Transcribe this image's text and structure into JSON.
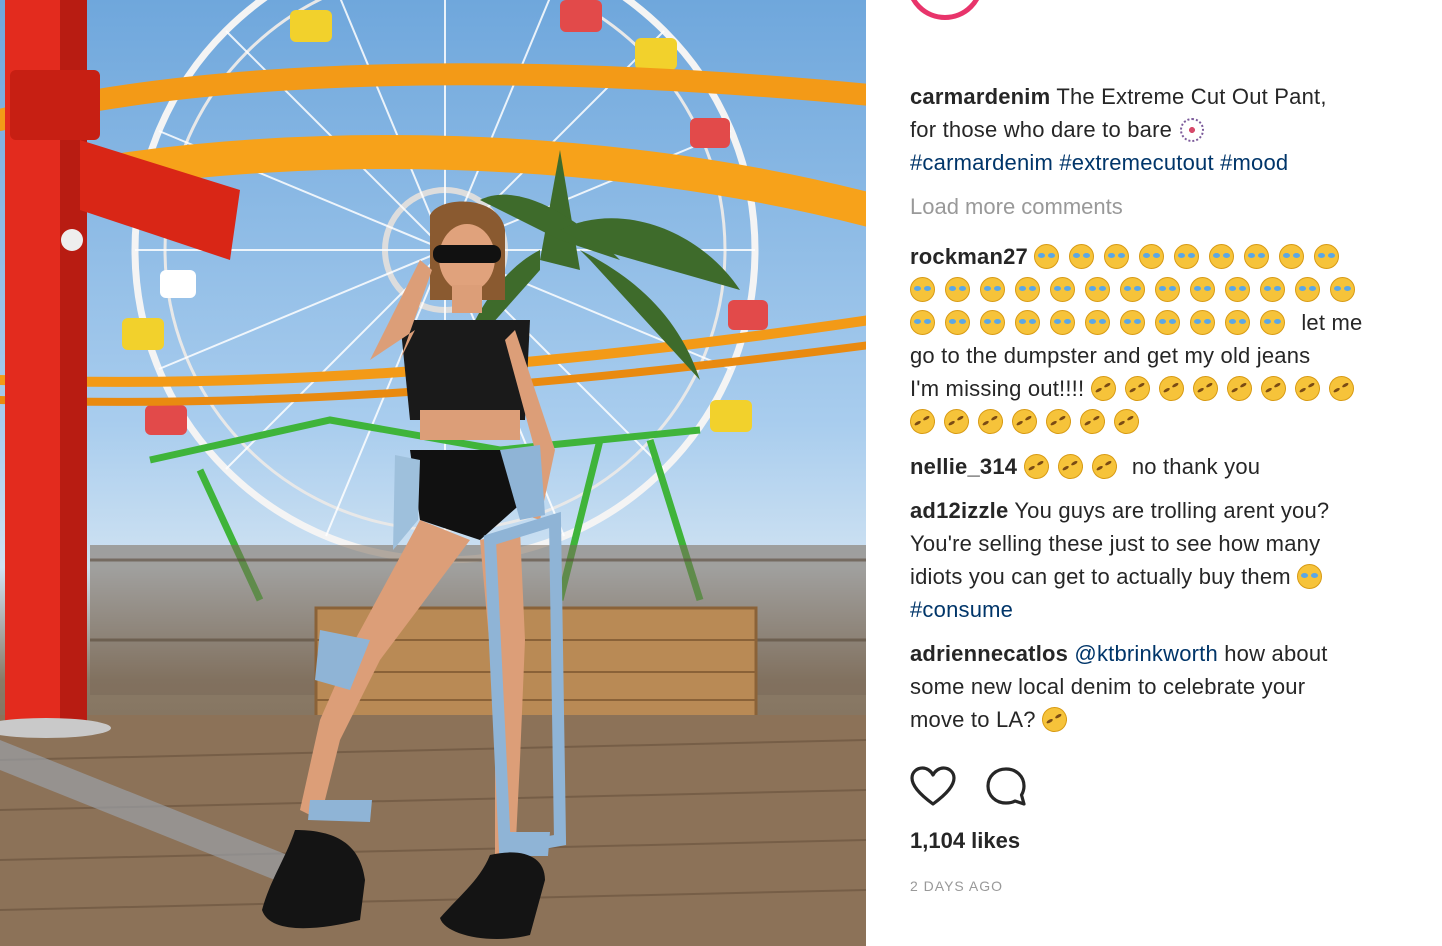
{
  "post": {
    "image_alt": "Photo of a woman wearing extreme cut-out jeans at an amusement pier",
    "author": "carmardenim",
    "caption_text_1": "The Extreme Cut Out Pant,",
    "caption_text_2": "for those who dare to bare",
    "hashtags": [
      "#carmardenim",
      "#extremecutout",
      "#mood"
    ]
  },
  "load_more_label": "Load more comments",
  "comments": [
    {
      "user": "rockman27",
      "text_1": "let me",
      "text_2": "go to the dumpster and get my old jeans",
      "text_3": "I'm missing out!!!!"
    },
    {
      "user": "nellie_314",
      "text": "no thank you"
    },
    {
      "user": "ad12izzle",
      "text_1": "You guys are trolling arent you?",
      "text_2": "You're selling these just to see how many",
      "text_3": "idiots you can get to actually buy them",
      "hashtag": "#consume"
    },
    {
      "user": "adriennecatlos",
      "mention": "@ktbrinkworth",
      "text_1": "how about",
      "text_2": "some new local denim to celebrate your",
      "text_3": "move to LA?"
    }
  ],
  "actions": {
    "like_icon": "heart-icon",
    "comment_icon": "comment-bubble-icon"
  },
  "likes_label": "1,104 likes",
  "timestamp": "2 DAYS AGO",
  "colors": {
    "link": "#003569",
    "text": "#262626",
    "muted": "#999999",
    "avatar_ring": "#e8346b"
  }
}
